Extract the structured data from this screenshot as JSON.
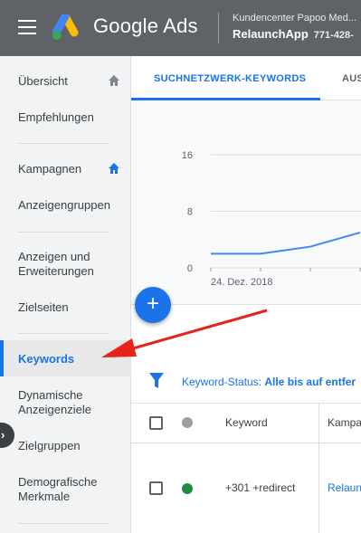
{
  "header": {
    "brand": "Google Ads",
    "account_name": "Kundencenter Papoo Med...",
    "account_label": "RelaunchApp",
    "customer_id": "771-428-"
  },
  "sidebar": {
    "items": [
      {
        "label": "Übersicht",
        "icon": "home-icon"
      },
      {
        "label": "Empfehlungen"
      },
      {
        "label": "Kampagnen",
        "icon": "home-icon"
      },
      {
        "label": "Anzeigengruppen"
      },
      {
        "label": "Anzeigen und Erweiterungen"
      },
      {
        "label": "Zielseiten"
      },
      {
        "label": "Keywords",
        "active": true
      },
      {
        "label": "Dynamische Anzeigenziele"
      },
      {
        "label": "Zielgruppen"
      },
      {
        "label": "Demografische Merkmale"
      }
    ],
    "expander_icon": "chevron-right-icon"
  },
  "tabs": {
    "active": "SUCHNETZWERK-KEYWORDS",
    "other": "AUS"
  },
  "chart_data": {
    "type": "line",
    "x": [
      "24. Dez. 2018",
      "",
      "",
      ""
    ],
    "values": [
      2,
      2,
      3,
      5
    ],
    "xlabel": "",
    "ylabel": "",
    "ylim": [
      0,
      16
    ],
    "yticks": [
      "16",
      "8",
      "0"
    ],
    "grid": true,
    "color": "#4285f4"
  },
  "fab": {
    "label": "+"
  },
  "filter": {
    "label": "Keyword-Status:",
    "value": "Alle bis auf entfer"
  },
  "table": {
    "headers": [
      "Keyword",
      "Kampa"
    ],
    "rows": [
      {
        "keyword": "+301 +redirect",
        "campaign": "Relaun",
        "status_color": "#1e8e3e"
      }
    ]
  },
  "colors": {
    "accent": "#1a73e8",
    "header_bg": "#5f6368",
    "annotation": "#e8221b"
  }
}
